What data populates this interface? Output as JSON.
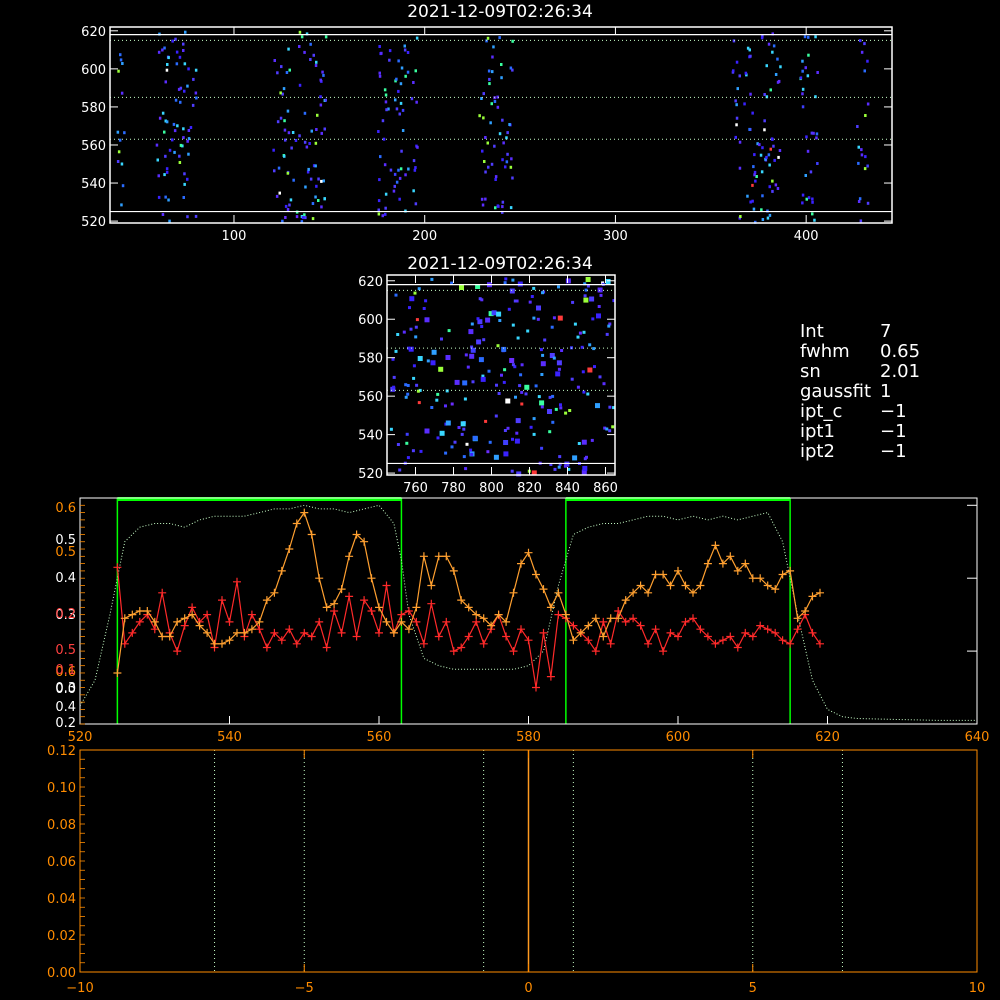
{
  "info_panel": [
    {
      "key": "Int",
      "value": "7"
    },
    {
      "key": "fwhm",
      "value": "0.65"
    },
    {
      "key": "sn",
      "value": "2.01"
    },
    {
      "key": "gaussfit",
      "value": "1"
    },
    {
      "key": "ipt_c",
      "value": "−1"
    },
    {
      "key": "ipt1",
      "value": "−1"
    },
    {
      "key": "ipt2",
      "value": "−1"
    }
  ],
  "colors": {
    "background": "#000000",
    "frame": "#ffffff",
    "axis_orange": "#ff8c00",
    "red_series": "#ff2a2a",
    "orange_series": "#ffa030",
    "green_box": "#00ff00",
    "dotted_profile": "#c8ffc8",
    "orange_axis_text": "#ff8c00",
    "red_axis_text": "#ff4040"
  },
  "chart_data": [
    {
      "type": "heatmap",
      "title": "2021-12-09T02:26:34",
      "xlim": [
        35,
        445
      ],
      "ylim": [
        519,
        622
      ],
      "xticks": [
        100,
        200,
        300,
        400
      ],
      "yticks": [
        520,
        540,
        560,
        580,
        600,
        620
      ],
      "solid_hlines": [
        525,
        618
      ],
      "dotted_hlines": [
        563,
        585,
        615
      ],
      "pixel_columns": [
        [
          38,
          42
        ],
        [
          58,
          80
        ],
        [
          120,
          148
        ],
        [
          175,
          196
        ],
        [
          228,
          246
        ],
        [
          360,
          386
        ],
        [
          396,
          406
        ],
        [
          426,
          432
        ]
      ]
    },
    {
      "type": "heatmap",
      "title": "2021-12-09T02:26:34",
      "xlim": [
        745,
        865
      ],
      "ylim": [
        519,
        623
      ],
      "xticks": [
        760,
        780,
        800,
        820,
        840,
        860
      ],
      "yticks": [
        520,
        540,
        560,
        580,
        600,
        620
      ],
      "solid_hlines": [
        525,
        618
      ],
      "dotted_hlines": [
        563,
        585,
        615
      ]
    },
    {
      "type": "line",
      "xlim": [
        520,
        640
      ],
      "ylim": [
        0,
        0.62
      ],
      "xticks": [
        520,
        540,
        560,
        580,
        600,
        620,
        640
      ],
      "yticks_left_white": [
        0.0,
        0.2,
        0.4,
        0.6
      ],
      "yticks_left_stacked": [
        "0.6",
        "0.5",
        "0.4",
        "0.3",
        "0.5",
        "0.6",
        "0.3",
        "0.4",
        "0.2",
        "0.5",
        "0.2",
        "0.1",
        "0.0"
      ],
      "green_boxes": [
        [
          525,
          563
        ],
        [
          585,
          615
        ]
      ],
      "series": [
        {
          "color": "red",
          "x": [
            525,
            526,
            527,
            528,
            529,
            530,
            531,
            532,
            533,
            534,
            535,
            536,
            537,
            538,
            539,
            540,
            541,
            542,
            543,
            544,
            545,
            546,
            547,
            548,
            549,
            550,
            551,
            552,
            553,
            554,
            555,
            556,
            557,
            558,
            559,
            560,
            561,
            562,
            563,
            564,
            565,
            566,
            567,
            568,
            569,
            570,
            571,
            572,
            573,
            574,
            575,
            576,
            577,
            578,
            579,
            580,
            581,
            582,
            583,
            584,
            585,
            586,
            587,
            588,
            589,
            590,
            591,
            592,
            593,
            594,
            595,
            596,
            597,
            598,
            599,
            600,
            601,
            602,
            603,
            604,
            605,
            606,
            607,
            608,
            609,
            610,
            611,
            612,
            613,
            614,
            615,
            616,
            617,
            618,
            619
          ],
          "values": [
            0.43,
            0.22,
            0.25,
            0.28,
            0.3,
            0.26,
            0.36,
            0.25,
            0.2,
            0.27,
            0.32,
            0.28,
            0.3,
            0.21,
            0.34,
            0.28,
            0.39,
            0.24,
            0.3,
            0.26,
            0.21,
            0.25,
            0.23,
            0.26,
            0.22,
            0.25,
            0.24,
            0.28,
            0.21,
            0.31,
            0.25,
            0.35,
            0.24,
            0.34,
            0.31,
            0.25,
            0.38,
            0.25,
            0.3,
            0.31,
            0.28,
            0.22,
            0.33,
            0.24,
            0.28,
            0.2,
            0.21,
            0.24,
            0.28,
            0.22,
            0.26,
            0.3,
            0.24,
            0.2,
            0.26,
            0.23,
            0.1,
            0.25,
            0.13,
            0.3,
            0.29,
            0.27,
            0.25,
            0.23,
            0.2,
            0.28,
            0.22,
            0.31,
            0.28,
            0.29,
            0.27,
            0.22,
            0.26,
            0.2,
            0.25,
            0.24,
            0.28,
            0.29,
            0.26,
            0.24,
            0.22,
            0.23,
            0.24,
            0.21,
            0.25,
            0.24,
            0.27,
            0.26,
            0.25,
            0.23,
            0.22,
            0.26,
            0.3,
            0.25,
            0.22
          ]
        },
        {
          "color": "orange",
          "x": [
            525,
            526,
            527,
            528,
            529,
            530,
            531,
            532,
            533,
            534,
            535,
            536,
            537,
            538,
            539,
            540,
            541,
            542,
            543,
            544,
            545,
            546,
            547,
            548,
            549,
            550,
            551,
            552,
            553,
            554,
            555,
            556,
            557,
            558,
            559,
            560,
            561,
            562,
            563,
            564,
            565,
            566,
            567,
            568,
            569,
            570,
            571,
            572,
            573,
            574,
            575,
            576,
            577,
            578,
            579,
            580,
            581,
            582,
            583,
            584,
            585,
            586,
            587,
            588,
            589,
            590,
            591,
            592,
            593,
            594,
            595,
            596,
            597,
            598,
            599,
            600,
            601,
            602,
            603,
            604,
            605,
            606,
            607,
            608,
            609,
            610,
            611,
            612,
            613,
            614,
            615,
            616,
            617,
            618,
            619
          ],
          "values": [
            0.14,
            0.29,
            0.3,
            0.31,
            0.31,
            0.28,
            0.24,
            0.24,
            0.28,
            0.29,
            0.3,
            0.27,
            0.25,
            0.22,
            0.22,
            0.23,
            0.25,
            0.25,
            0.26,
            0.28,
            0.34,
            0.36,
            0.42,
            0.48,
            0.55,
            0.58,
            0.52,
            0.4,
            0.32,
            0.33,
            0.37,
            0.46,
            0.52,
            0.5,
            0.4,
            0.32,
            0.28,
            0.25,
            0.28,
            0.26,
            0.32,
            0.46,
            0.38,
            0.46,
            0.46,
            0.42,
            0.34,
            0.32,
            0.3,
            0.29,
            0.27,
            0.3,
            0.28,
            0.36,
            0.44,
            0.47,
            0.41,
            0.37,
            0.32,
            0.36,
            0.3,
            0.23,
            0.25,
            0.27,
            0.29,
            0.24,
            0.29,
            0.29,
            0.34,
            0.36,
            0.38,
            0.36,
            0.41,
            0.41,
            0.38,
            0.42,
            0.38,
            0.36,
            0.38,
            0.44,
            0.49,
            0.44,
            0.46,
            0.42,
            0.44,
            0.4,
            0.4,
            0.38,
            0.37,
            0.41,
            0.42,
            0.29,
            0.31,
            0.35,
            0.36
          ]
        },
        {
          "color": "dotted-white",
          "x": [
            520,
            522,
            524,
            526,
            528,
            530,
            532,
            534,
            536,
            538,
            540,
            542,
            544,
            546,
            548,
            550,
            552,
            554,
            556,
            558,
            560,
            562,
            563,
            564,
            566,
            568,
            570,
            572,
            574,
            576,
            578,
            580,
            582,
            584,
            586,
            588,
            590,
            592,
            594,
            596,
            598,
            600,
            602,
            604,
            606,
            608,
            610,
            612,
            614,
            616,
            618,
            620,
            622,
            624,
            630,
            635,
            640
          ],
          "values": [
            0.05,
            0.12,
            0.3,
            0.5,
            0.54,
            0.55,
            0.55,
            0.54,
            0.56,
            0.57,
            0.57,
            0.57,
            0.58,
            0.59,
            0.59,
            0.6,
            0.59,
            0.59,
            0.58,
            0.59,
            0.6,
            0.55,
            0.45,
            0.3,
            0.18,
            0.16,
            0.15,
            0.15,
            0.15,
            0.15,
            0.15,
            0.16,
            0.2,
            0.38,
            0.52,
            0.54,
            0.55,
            0.55,
            0.56,
            0.57,
            0.57,
            0.56,
            0.57,
            0.56,
            0.57,
            0.56,
            0.57,
            0.58,
            0.5,
            0.3,
            0.12,
            0.04,
            0.02,
            0.015,
            0.012,
            0.01,
            0.01
          ]
        }
      ]
    },
    {
      "type": "line",
      "xlim": [
        -10,
        10
      ],
      "ylim": [
        0,
        0.12
      ],
      "xticks": [
        -10,
        -5,
        0,
        5,
        10
      ],
      "ytick_labels": [
        "0.12",
        "0.10",
        "0.08",
        "0.06",
        "0.04",
        "0.02",
        "0.00"
      ],
      "dotted_vlines": [
        -7,
        -5,
        -1,
        1,
        5,
        7
      ],
      "solid_vline": 0
    }
  ]
}
